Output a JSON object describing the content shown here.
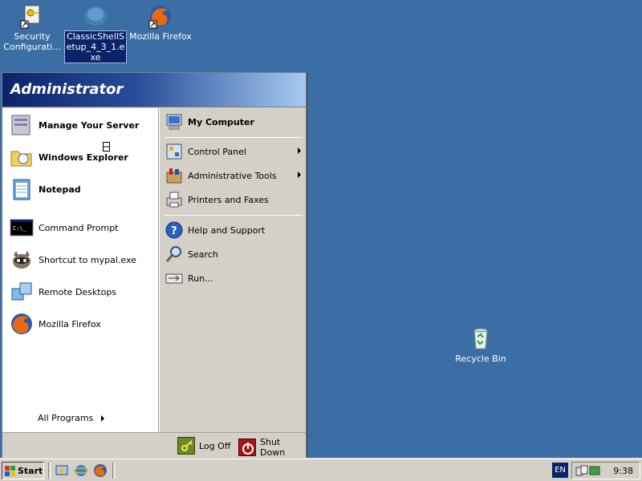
{
  "desktop": {
    "icons": [
      {
        "label": "Security Configurati...",
        "name": "security-config-icon"
      },
      {
        "label": "ClassicShellSetup_4_3_1.exe",
        "name": "classicshell-setup-icon"
      },
      {
        "label": "Mozilla Firefox",
        "name": "firefox-desktop-icon"
      },
      {
        "label": "Recycle Bin",
        "name": "recycle-bin-icon"
      }
    ]
  },
  "start_menu": {
    "user": "Administrator",
    "pinned": [
      {
        "label": "Manage Your Server",
        "icon": "server-icon"
      },
      {
        "label": "Windows Explorer",
        "icon": "explorer-folder-icon"
      },
      {
        "label": "Notepad",
        "icon": "notepad-icon"
      }
    ],
    "recent": [
      {
        "label": "Command Prompt",
        "icon": "command-prompt-icon"
      },
      {
        "label": "Shortcut to mypal.exe",
        "icon": "mypal-raccoon-icon"
      },
      {
        "label": "Remote Desktops",
        "icon": "remote-desktops-icon"
      },
      {
        "label": "Mozilla Firefox",
        "icon": "firefox-icon"
      }
    ],
    "all_programs": "All Programs",
    "right": {
      "my_computer": "My Computer",
      "items": [
        {
          "label": "Control Panel",
          "icon": "control-panel-icon",
          "submenu": true
        },
        {
          "label": "Administrative Tools",
          "icon": "admin-tools-icon",
          "submenu": true
        },
        {
          "label": "Printers and Faxes",
          "icon": "printer-icon",
          "submenu": false
        }
      ],
      "items2": [
        {
          "label": "Help and Support",
          "icon": "help-icon"
        },
        {
          "label": "Search",
          "icon": "search-icon"
        },
        {
          "label": "Run...",
          "icon": "run-icon"
        }
      ]
    },
    "log_off": "Log Off",
    "shut_down": "Shut Down"
  },
  "taskbar": {
    "start": "Start",
    "language": "EN",
    "clock": "9:38"
  },
  "colors": {
    "desktop": "#3a6ea5",
    "header_dark": "#0a246a",
    "header_light": "#a6caf0"
  }
}
